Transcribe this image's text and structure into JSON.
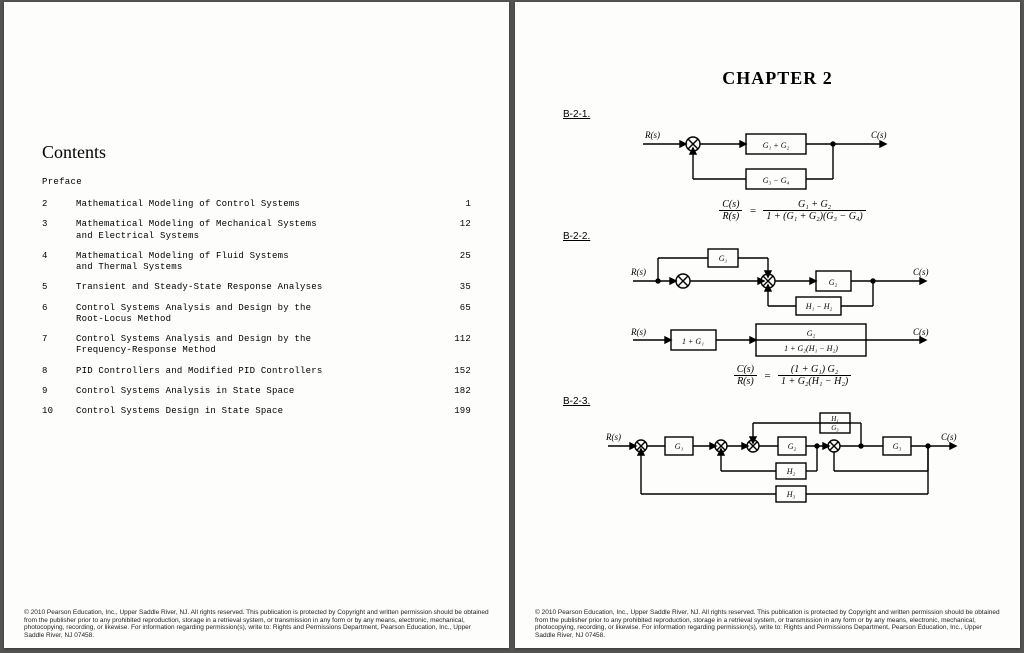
{
  "left": {
    "title": "Contents",
    "preface": "Preface",
    "toc": [
      {
        "n": "2",
        "t": "Mathematical Modeling of Control Systems",
        "p": "1"
      },
      {
        "n": "3",
        "t": "Mathematical Modeling of Mechanical Systems\nand Electrical Systems",
        "p": "12"
      },
      {
        "n": "4",
        "t": "Mathematical Modeling of Fluid Systems\nand Thermal Systems",
        "p": "25"
      },
      {
        "n": "5",
        "t": "Transient and Steady-State Response Analyses",
        "p": "35"
      },
      {
        "n": "6",
        "t": "Control Systems Analysis and Design by the\nRoot-Locus Method",
        "p": "65"
      },
      {
        "n": "7",
        "t": "Control Systems Analysis and Design by the\nFrequency-Response Method",
        "p": "112"
      },
      {
        "n": "8",
        "t": "PID Controllers and Modified PID Controllers",
        "p": "152"
      },
      {
        "n": "9",
        "t": "Control Systems Analysis in State Space",
        "p": "182"
      },
      {
        "n": "10",
        "t": "Control Systems Design in State Space",
        "p": "199"
      }
    ]
  },
  "right": {
    "chapter": "CHAPTER 2",
    "problems": {
      "p1": {
        "label": "B-2-1.",
        "sig": {
          "R": "R(s)",
          "C": "C(s)",
          "b1": "G₁ + G₂",
          "b2": "G₃ − G₄"
        },
        "eq": {
          "ln": "C(s)",
          "ld": "R(s)",
          "rn": "G₁ + G₂",
          "rd": "1 + (G₁ + G₂)(G₃ − G₄)"
        }
      },
      "p2": {
        "label": "B-2-2.",
        "sigA": {
          "R": "R(s)",
          "C": "C(s)",
          "b1": "G₁",
          "b2": "G₂",
          "b3": "H₁ − H₂"
        },
        "sigB": {
          "R": "R(s)",
          "C": "C(s)",
          "b1": "1 + G₁",
          "b2n": "G₂",
          "b2d": "1 + G₂(H₁ − H₂)"
        },
        "eq": {
          "ln": "C(s)",
          "ld": "R(s)",
          "rn": "(1 + G₁) G₂",
          "rd": "1 + G₂(H₁ − H₂)"
        }
      },
      "p3": {
        "label": "B-2-3.",
        "sig": {
          "R": "R(s)",
          "C": "C(s)",
          "b1": "G₁",
          "b2": "G₂",
          "b3": "G₃",
          "h1n": "H₁",
          "h1d": "G₃",
          "h2": "H₂",
          "h3": "H₃"
        }
      }
    }
  },
  "footer": "© 2010 Pearson Education, Inc., Upper Saddle River, NJ. All rights reserved. This publication is protected by Copyright and written permission should be obtained from the publisher prior to any prohibited reproduction, storage in a retrieval system, or transmission in any form or by any means, electronic, mechanical, photocopying, recording, or likewise. For information regarding permission(s), write to: Rights and Permissions Department, Pearson Education, Inc., Upper Saddle River, NJ 07458."
}
